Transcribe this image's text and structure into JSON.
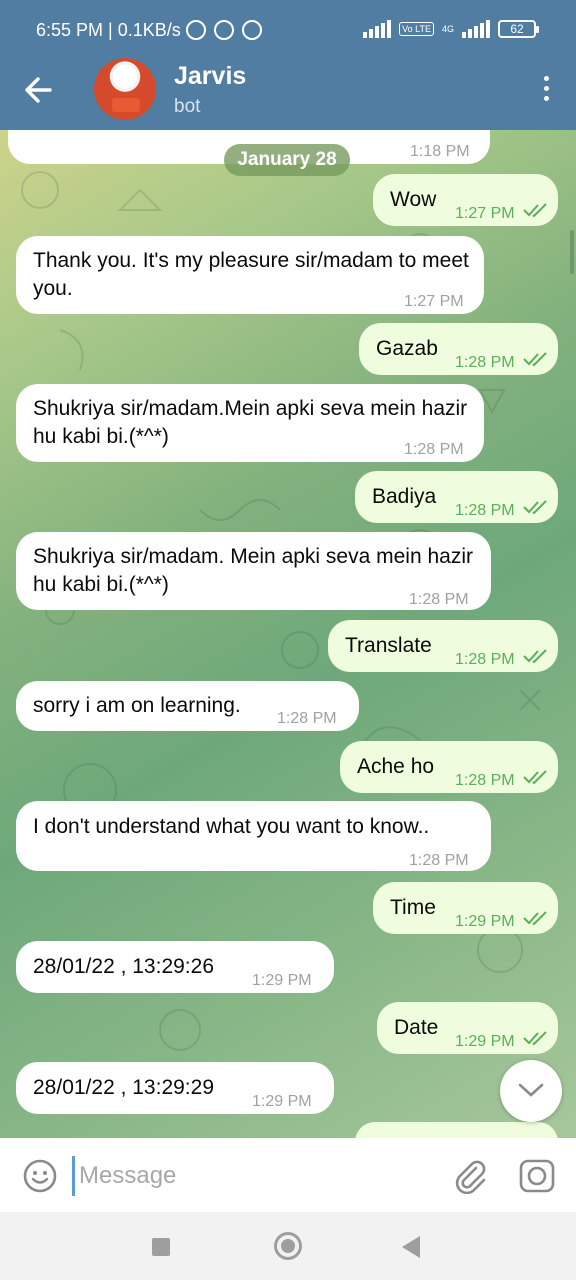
{
  "status_bar": {
    "time_speed": "6:55 PM | 0.1KB/s",
    "network_label": "4G",
    "volte_label": "Vo LTE",
    "battery": "62"
  },
  "header": {
    "name": "Jarvis",
    "subtitle": "bot"
  },
  "chat": {
    "date_chip": "January 28",
    "top_partial_time": "1:18 PM",
    "messages": [
      {
        "dir": "out",
        "text": "Wow",
        "time": "1:27 PM"
      },
      {
        "dir": "in",
        "text": "Thank you. It's my pleasure sir/madam to meet you.",
        "time": "1:27 PM"
      },
      {
        "dir": "out",
        "text": "Gazab",
        "time": "1:28 PM"
      },
      {
        "dir": "in",
        "text": "Shukriya sir/madam.Mein apki seva mein hazir hu kabi bi.(*^*)",
        "time": "1:28 PM"
      },
      {
        "dir": "out",
        "text": "Badiya",
        "time": "1:28 PM"
      },
      {
        "dir": "in",
        "text": "Shukriya sir/madam. Mein apki seva mein hazir hu kabi bi.(*^*)",
        "time": "1:28 PM"
      },
      {
        "dir": "out",
        "text": "Translate",
        "time": "1:28 PM"
      },
      {
        "dir": "in",
        "text": "sorry i am on learning.",
        "time": "1:28 PM"
      },
      {
        "dir": "out",
        "text": "Ache ho",
        "time": "1:28 PM"
      },
      {
        "dir": "in",
        "text": "I don't understand what you want to know..",
        "time": "1:28 PM"
      },
      {
        "dir": "out",
        "text": "Time",
        "time": "1:29 PM"
      },
      {
        "dir": "in",
        "text": "28/01/22 , 13:29:26",
        "time": "1:29 PM"
      },
      {
        "dir": "out",
        "text": "Date",
        "time": "1:29 PM"
      },
      {
        "dir": "in",
        "text": "28/01/22 , 13:29:29",
        "time": "1:29 PM"
      }
    ]
  },
  "input": {
    "placeholder": "Message"
  },
  "colors": {
    "header": "#517da2",
    "out_bubble": "#effdde",
    "in_bubble": "#ffffff",
    "out_time": "#5cae5c"
  }
}
